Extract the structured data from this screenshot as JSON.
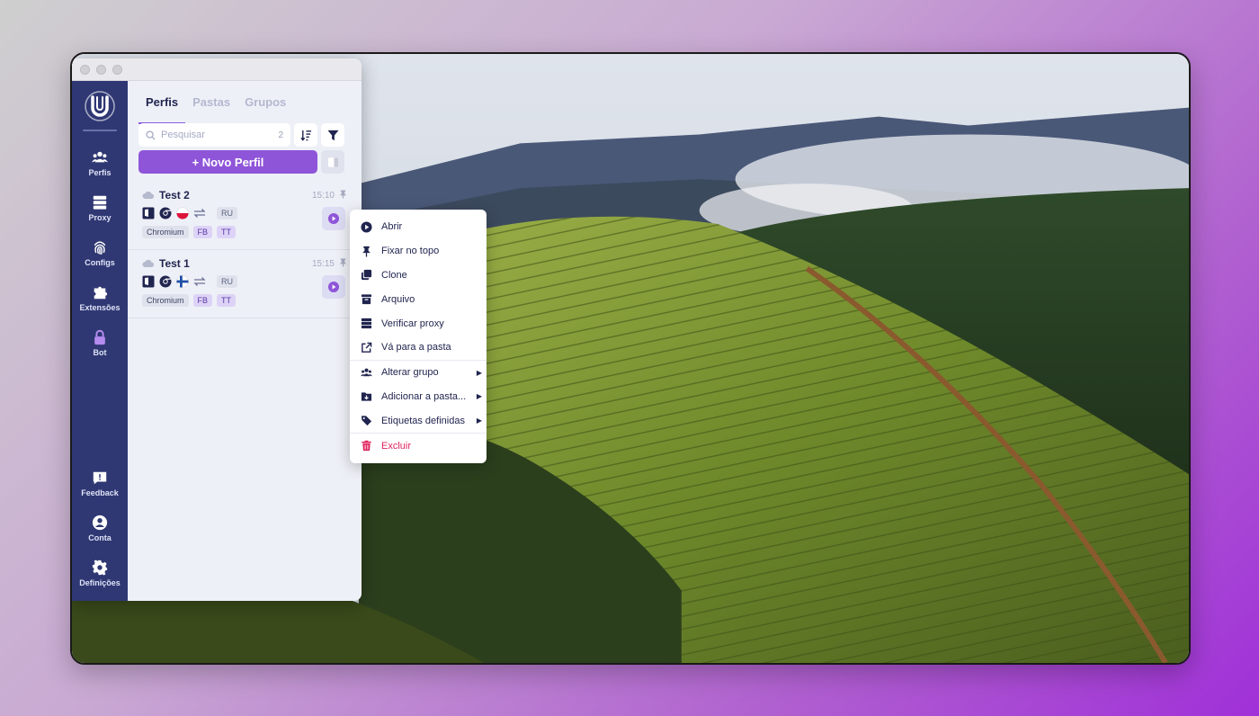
{
  "sidebar": {
    "items": [
      {
        "label": "Perfis",
        "icon": "users-icon"
      },
      {
        "label": "Proxy",
        "icon": "server-icon"
      },
      {
        "label": "Configs",
        "icon": "fingerprint-icon"
      },
      {
        "label": "Extensões",
        "icon": "puzzle-icon"
      },
      {
        "label": "Bot",
        "icon": "lock-icon"
      }
    ],
    "bottom_items": [
      {
        "label": "Feedback",
        "icon": "feedback-icon"
      },
      {
        "label": "Conta",
        "icon": "account-icon"
      },
      {
        "label": "Definições",
        "icon": "gear-icon"
      }
    ],
    "bot_color": "#b58bf0"
  },
  "tabs": [
    "Perfis",
    "Pastas",
    "Grupos"
  ],
  "search": {
    "placeholder": "Pesquisar",
    "count": "2"
  },
  "new_profile_label": "+ Novo Perfil",
  "profiles": [
    {
      "name": "Test 2",
      "time": "15:10",
      "flag": "poland",
      "country_tag": "RU",
      "tags": [
        "Chromium",
        "FB",
        "TT"
      ]
    },
    {
      "name": "Test 1",
      "time": "15:15",
      "flag": "finland",
      "country_tag": "RU",
      "tags": [
        "Chromium",
        "FB",
        "TT"
      ]
    }
  ],
  "context_menu": {
    "items": [
      {
        "label": "Abrir",
        "icon": "play-circle-icon"
      },
      {
        "label": "Fixar no topo",
        "icon": "pin-icon"
      },
      {
        "label": "Clone",
        "icon": "clone-icon"
      },
      {
        "label": "Arquivo",
        "icon": "archive-icon"
      },
      {
        "label": "Verificar proxy",
        "icon": "server-icon"
      },
      {
        "label": "Vá para a pasta",
        "icon": "external-link-icon"
      },
      {
        "label": "Alterar grupo",
        "icon": "users-icon",
        "submenu": true
      },
      {
        "label": "Adicionar a pasta...",
        "icon": "folder-download-icon",
        "submenu": true
      },
      {
        "label": "Etiquetas definidas",
        "icon": "tag-icon",
        "submenu": true
      },
      {
        "label": "Excluir",
        "icon": "trash-icon",
        "danger": true
      }
    ]
  },
  "colors": {
    "accent": "#8f55d9",
    "sidebar": "#2f3873",
    "danger": "#e0245e"
  }
}
